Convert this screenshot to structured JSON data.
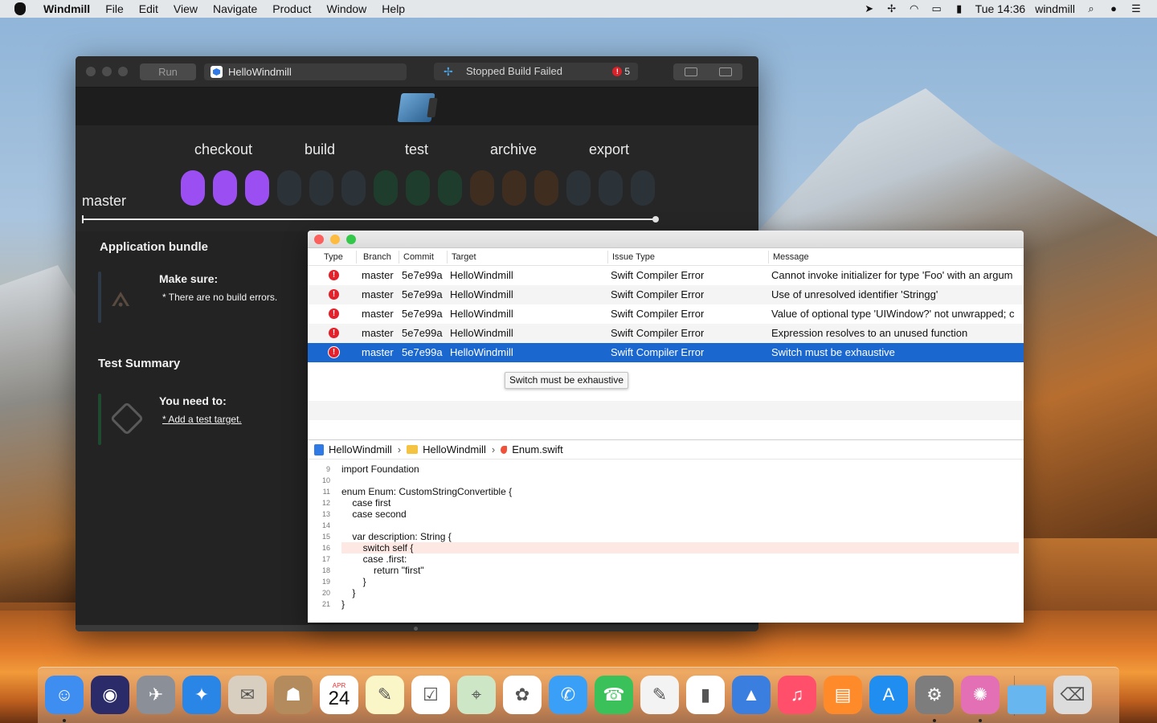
{
  "menubar": {
    "app_name": "Windmill",
    "items": [
      "File",
      "Edit",
      "View",
      "Navigate",
      "Product",
      "Window",
      "Help"
    ],
    "clock": "Tue 14:36",
    "user": "windmill"
  },
  "windmill": {
    "run_label": "Run",
    "scheme": "HelloWindmill",
    "status": "Stopped Build Failed",
    "error_count": "5",
    "branch": "master",
    "stages": [
      "checkout",
      "build",
      "test",
      "archive",
      "export"
    ],
    "colors": {
      "checkout": "#9b4ff2",
      "build": "#2b3238",
      "test": "#1f3d2c",
      "archive": "#3f2e20",
      "export": "#2b3238"
    },
    "application_bundle": {
      "title": "Application bundle",
      "heading": "Make sure:",
      "bullet": "* There are no build errors."
    },
    "test_summary": {
      "title": "Test Summary",
      "heading": "You need to:",
      "link": "* Add a test target."
    }
  },
  "issues": {
    "columns": [
      "Type",
      "Branch",
      "Commit",
      "Target",
      "Issue Type",
      "Message"
    ],
    "rows": [
      {
        "branch": "master",
        "commit": "5e7e99a",
        "target": "HelloWindmill",
        "issue_type": "Swift Compiler Error",
        "message": "Cannot invoke initializer for type 'Foo' with an argum"
      },
      {
        "branch": "master",
        "commit": "5e7e99a",
        "target": "HelloWindmill",
        "issue_type": "Swift Compiler Error",
        "message": "Use of unresolved identifier 'Stringg'"
      },
      {
        "branch": "master",
        "commit": "5e7e99a",
        "target": "HelloWindmill",
        "issue_type": "Swift Compiler Error",
        "message": "Value of optional type 'UIWindow?' not unwrapped; c"
      },
      {
        "branch": "master",
        "commit": "5e7e99a",
        "target": "HelloWindmill",
        "issue_type": "Swift Compiler Error",
        "message": "Expression resolves to an unused function"
      },
      {
        "branch": "master",
        "commit": "5e7e99a",
        "target": "HelloWindmill",
        "issue_type": "Swift Compiler Error",
        "message": "Switch must be exhaustive"
      }
    ],
    "selected_index": 4,
    "tooltip": "Switch must be exhaustive",
    "breadcrumb": [
      "HelloWindmill",
      "HelloWindmill",
      "Enum.swift"
    ],
    "code": [
      {
        "n": "9",
        "t": "import Foundation"
      },
      {
        "n": "10",
        "t": ""
      },
      {
        "n": "11",
        "t": "enum Enum: CustomStringConvertible {"
      },
      {
        "n": "12",
        "t": "    case first"
      },
      {
        "n": "13",
        "t": "    case second"
      },
      {
        "n": "14",
        "t": ""
      },
      {
        "n": "15",
        "t": "    var description: String {"
      },
      {
        "n": "16",
        "t": "        switch self {"
      },
      {
        "n": "17",
        "t": "        case .first:"
      },
      {
        "n": "18",
        "t": "            return \"first\""
      },
      {
        "n": "19",
        "t": "        }"
      },
      {
        "n": "20",
        "t": "    }"
      },
      {
        "n": "21",
        "t": "}"
      }
    ],
    "highlight_line": "16"
  },
  "dock": {
    "apps": [
      "Finder",
      "Siri",
      "Launchpad",
      "Safari",
      "Mail",
      "Contacts",
      "Calendar",
      "Notes",
      "Reminders",
      "Maps",
      "Photos",
      "Messages",
      "FaceTime",
      "Pages",
      "Numbers",
      "Keynote",
      "iTunes",
      "iBooks",
      "App Store",
      "System Preferences",
      "Windmill",
      "Downloads",
      "Trash"
    ],
    "calendar_month": "APR",
    "calendar_day": "24"
  }
}
